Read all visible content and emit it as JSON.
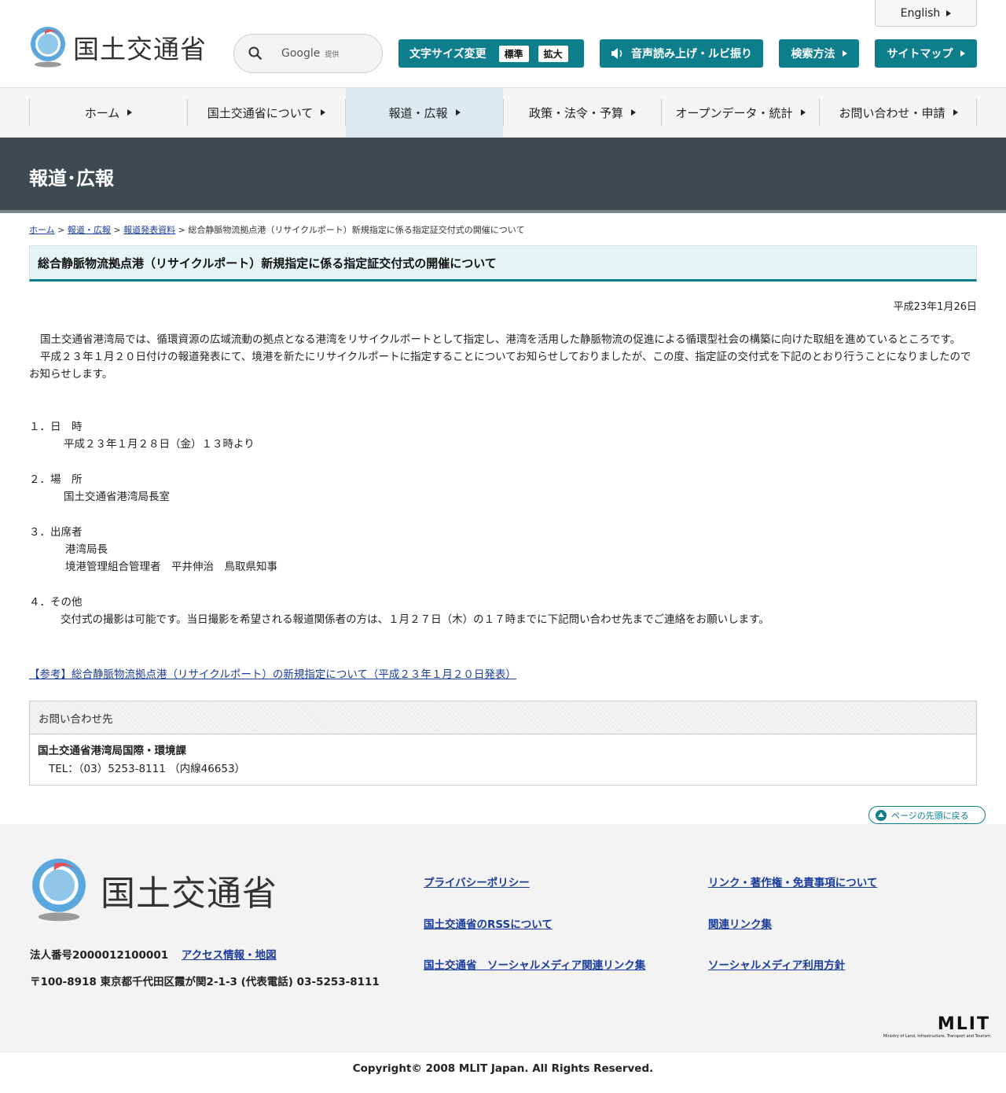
{
  "header": {
    "logo_text": "国土交通省",
    "english": "English",
    "search": {
      "google_label": "Google",
      "google_sub": "提供"
    },
    "font_size": {
      "label": "文字サイズ変更",
      "opt_standard": "標準",
      "opt_large": "拡大"
    },
    "voice": "音声読み上げ・ルビ振り",
    "search_method": "検索方法",
    "sitemap": "サイトマップ"
  },
  "nav": {
    "home": "ホーム",
    "about": "国土交通省について",
    "press": "報道・広報",
    "policy": "政策・法令・予算",
    "opendata": "オープンデータ・統計",
    "contact": "お問い合わせ・申請"
  },
  "page": {
    "band_title": "報道･広報",
    "breadcrumb": {
      "home": "ホーム",
      "press": "報道・広報",
      "release": "報道発表資料",
      "current": "総合静脈物流拠点港（リサイクルポート）新規指定に係る指定証交付式の開催について",
      "sep": ">"
    },
    "title": "総合静脈物流拠点港（リサイクルポート）新規指定に係る指定証交付式の開催について",
    "date": "平成23年1月26日",
    "para1": "国土交通省港湾局では、循環資源の広域流動の拠点となる港湾をリサイクルポートとして指定し、港湾を活用した静脈物流の促進による循環型社会の構築に向けた取組を進めているところです。",
    "para2": "平成２３年１月２０日付けの報道発表にて、境港を新たにリサイクルポートに指定することについてお知らせしておりましたが、この度、指定証の交付式を下記のとおり行うことになりましたのでお知らせします。",
    "sec1_title": "１．日　時",
    "sec1_body": "平成２３年１月２８日（金）１３時より",
    "sec2_title": "２．場　所",
    "sec2_body": "国土交通省港湾局長室",
    "sec3_title": "３．出席者",
    "sec3_body1": "港湾局長",
    "sec3_body2": "境港管理組合管理者　平井伸治　鳥取県知事",
    "sec4_title": "４．その他",
    "sec4_body": "交付式の撮影は可能です。当日撮影を希望される報道関係者の方は、１月２７日（木）の１７時までに下記問い合わせ先までご連絡をお願いします。",
    "ref_link": "【参考】総合静脈物流拠点港（リサイクルポート）の新規指定について（平成２３年１月２０日発表）",
    "contact_head": "お問い合わせ先",
    "contact_org": "国土交通省港湾局国際・環境課",
    "contact_tel": "TEL：（03）5253-8111 （内線46653）",
    "pagetop": "ページの先頭に戻る"
  },
  "footer": {
    "logo_text": "国土交通省",
    "corp_no": "法人番号2000012100001",
    "access": "アクセス情報・地図",
    "address": "〒100-8918 東京都千代田区霞が関2-1-3 (代表電話) 03-5253-8111",
    "privacy": "プライバシーポリシー",
    "rss": "国土交通省のRSSについて",
    "social_links": "国土交通省　ソーシャルメディア関連リンク集",
    "copyright_links": "リンク・著作権・免責事項について",
    "related": "関連リンク集",
    "social_policy": "ソーシャルメディア利用方針",
    "mlit_big": "MLIT",
    "mlit_small": "Ministry of Land, Infrastructure, Transport and Tourism",
    "copyright": "Copyright© 2008 MLIT Japan. All Rights Reserved."
  },
  "colors": {
    "accent": "#0e7d8c",
    "band": "#3e4a50",
    "link": "#1a3c9c"
  }
}
